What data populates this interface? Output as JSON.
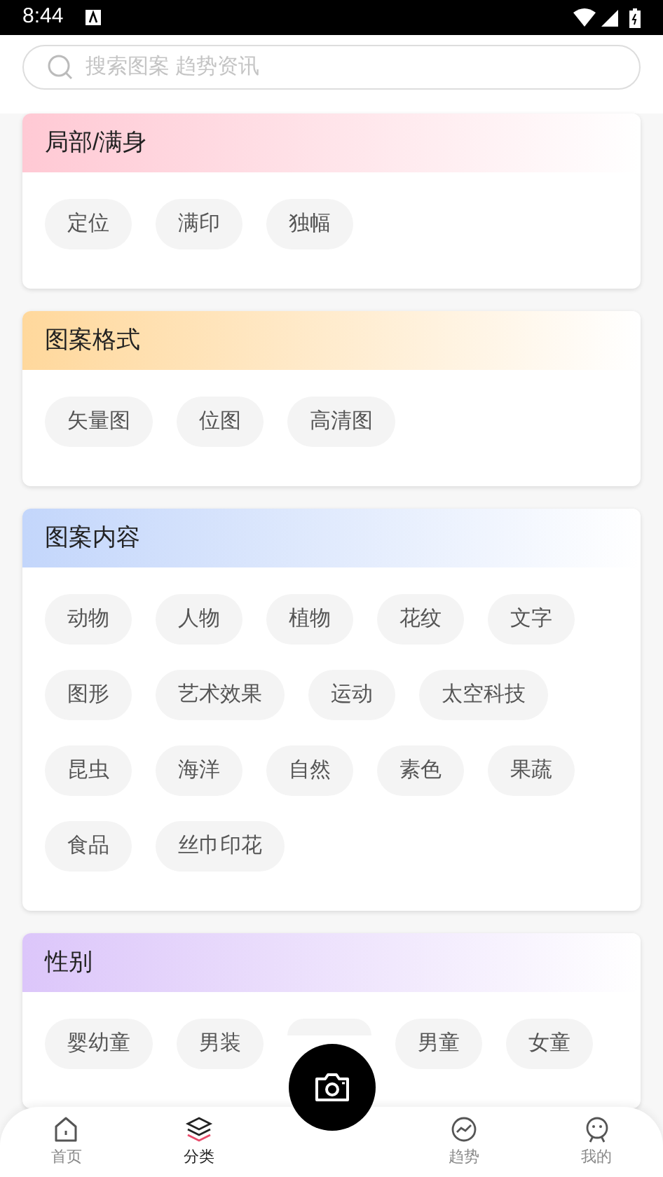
{
  "status_bar": {
    "time": "8:44"
  },
  "search": {
    "placeholder": "搜索图案 趋势资讯"
  },
  "sections": [
    {
      "title": "局部/满身",
      "color": "#ffc9d4",
      "chips": [
        {
          "label": "定位"
        },
        {
          "label": "满印"
        },
        {
          "label": "独幅"
        }
      ]
    },
    {
      "title": "图案格式",
      "color": "#ffd89c",
      "chips": [
        {
          "label": "矢量图"
        },
        {
          "label": "位图"
        },
        {
          "label": "高清图"
        }
      ]
    },
    {
      "title": "图案内容",
      "color": "#c3d6fb",
      "chips": [
        {
          "label": "动物"
        },
        {
          "label": "人物"
        },
        {
          "label": "植物"
        },
        {
          "label": "花纹"
        },
        {
          "label": "文字"
        },
        {
          "label": "图形"
        },
        {
          "label": "艺术效果"
        },
        {
          "label": "运动"
        },
        {
          "label": "太空科技"
        },
        {
          "label": "昆虫"
        },
        {
          "label": "海洋"
        },
        {
          "label": "自然"
        },
        {
          "label": "素色"
        },
        {
          "label": "果蔬"
        },
        {
          "label": "食品"
        },
        {
          "label": "丝巾印花"
        }
      ]
    },
    {
      "title": "性别",
      "color": "#dcc6fa",
      "chips": [
        {
          "label": "婴幼童"
        },
        {
          "label": "男装"
        },
        {
          "kind": "covered"
        },
        {
          "label": "男童"
        },
        {
          "label": "女童"
        }
      ]
    }
  ],
  "tabs": [
    {
      "label": "首页",
      "kind": "home",
      "selected": false
    },
    {
      "label": "分类",
      "kind": "layers",
      "selected": true
    },
    {
      "kind": "camera"
    },
    {
      "label": "趋势",
      "kind": "trend",
      "selected": false
    },
    {
      "label": "我的",
      "kind": "face",
      "selected": false
    }
  ]
}
